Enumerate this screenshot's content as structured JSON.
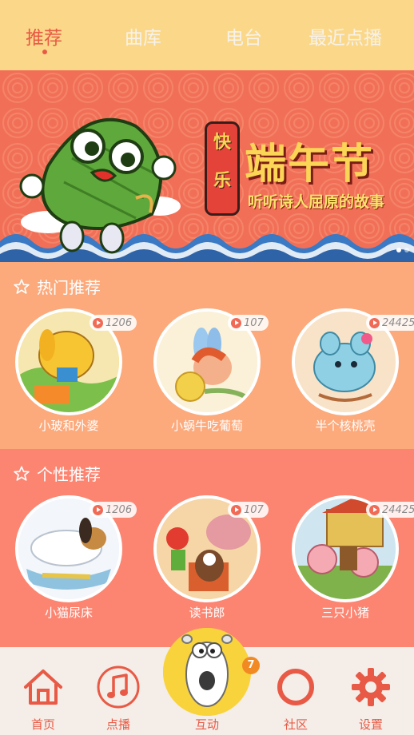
{
  "tabs": [
    {
      "label": "推荐",
      "active": true
    },
    {
      "label": "曲库",
      "active": false
    },
    {
      "label": "电台",
      "active": false
    },
    {
      "label": "最近点播",
      "active": false
    }
  ],
  "banner": {
    "lantern_top": "快",
    "lantern_bottom": "乐",
    "title": "端午节",
    "subtitle": "听听诗人屈原的故事",
    "page_count": 2,
    "active_page": 1
  },
  "hot": {
    "title": "热门推荐",
    "icon": "star-outline-icon",
    "items": [
      {
        "title": "小玻和外婆",
        "plays": "1206"
      },
      {
        "title": "小蜗牛吃葡萄",
        "plays": "107"
      },
      {
        "title": "半个核桃壳",
        "plays": "24425"
      }
    ]
  },
  "personal": {
    "title": "个性推荐",
    "icon": "star-outline-icon",
    "items": [
      {
        "title": "小猫尿床",
        "plays": "1206"
      },
      {
        "title": "读书郎",
        "plays": "107"
      },
      {
        "title": "三只小猪",
        "plays": "24425"
      }
    ]
  },
  "nav": {
    "items": [
      {
        "label": "首页",
        "icon": "home-icon"
      },
      {
        "label": "点播",
        "icon": "music-note-icon"
      },
      {
        "label": "互动",
        "icon": "cartoon-bear-avatar"
      },
      {
        "label": "社区",
        "icon": "community-ring-icon"
      },
      {
        "label": "设置",
        "icon": "gear-icon"
      }
    ],
    "badge_count": "7"
  },
  "colors": {
    "accent": "#e85a45",
    "topbar": "#fbd889",
    "hot_bg": "#fca97b",
    "personal_bg": "#fc8572",
    "nav_bg": "#f4ede8",
    "badge": "#f28a23"
  }
}
